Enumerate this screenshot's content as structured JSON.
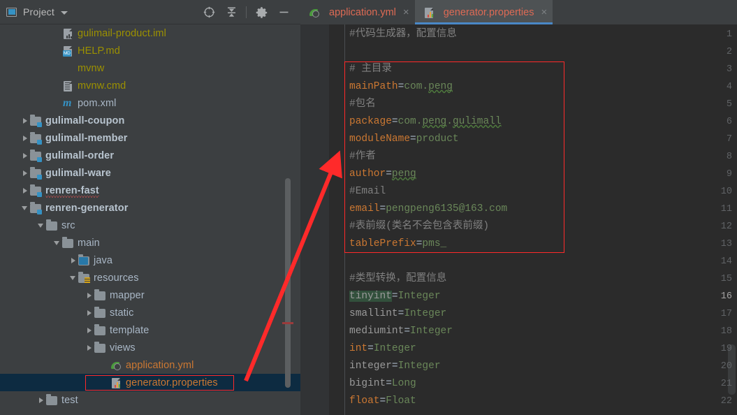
{
  "window": {
    "panel_title": "Project",
    "accent_blue": "#3592c4",
    "tab_underline": "#4a88c7",
    "annotation_red": "#ff2a2a",
    "sidebar_bg": "#3c3f41",
    "editor_bg": "#2b2b2b",
    "selection_bg": "#0d2b41"
  },
  "toolbar": {
    "icons": [
      {
        "name": "locate-target-icon",
        "title": "Select Opened File"
      },
      {
        "name": "collapse-all-icon",
        "title": "Collapse All"
      },
      {
        "name": "settings-gear-icon",
        "title": "Settings"
      },
      {
        "name": "minimize-icon",
        "title": "Hide"
      }
    ]
  },
  "tree": {
    "items": [
      {
        "label": "gulimail-product.iml",
        "indent": 3,
        "arrow": "none",
        "icon": "iml-file-icon",
        "style": "yellow"
      },
      {
        "label": "HELP.md",
        "indent": 3,
        "arrow": "none",
        "icon": "markdown-file-icon",
        "style": "yellow"
      },
      {
        "label": "mvnw",
        "indent": 3,
        "arrow": "none",
        "icon": "shell-script-icon",
        "style": "yellow"
      },
      {
        "label": "mvnw.cmd",
        "indent": 3,
        "arrow": "none",
        "icon": "cmd-script-icon",
        "style": "yellow"
      },
      {
        "label": "pom.xml",
        "indent": 3,
        "arrow": "none",
        "icon": "maven-pom-icon",
        "style": "plain"
      },
      {
        "label": "gulimall-coupon",
        "indent": 1,
        "arrow": "closed",
        "icon": "module-folder-icon",
        "style": "bold"
      },
      {
        "label": "gulimall-member",
        "indent": 1,
        "arrow": "closed",
        "icon": "module-folder-icon",
        "style": "bold"
      },
      {
        "label": "gulimall-order",
        "indent": 1,
        "arrow": "closed",
        "icon": "module-folder-icon",
        "style": "bold"
      },
      {
        "label": "gulimall-ware",
        "indent": 1,
        "arrow": "closed",
        "icon": "module-folder-icon",
        "style": "bold"
      },
      {
        "label": "renren-fast",
        "indent": 1,
        "arrow": "closed",
        "icon": "module-folder-icon",
        "style": "bold",
        "spellcheck_error": true
      },
      {
        "label": "renren-generator",
        "indent": 1,
        "arrow": "open",
        "icon": "module-folder-icon",
        "style": "bold"
      },
      {
        "label": "src",
        "indent": 2,
        "arrow": "open",
        "icon": "folder-icon",
        "style": "plain"
      },
      {
        "label": "main",
        "indent": 3,
        "arrow": "open",
        "icon": "folder-icon",
        "style": "plain"
      },
      {
        "label": "java",
        "indent": 4,
        "arrow": "closed",
        "icon": "sources-folder-icon",
        "style": "plain"
      },
      {
        "label": "resources",
        "indent": 4,
        "arrow": "open",
        "icon": "resources-folder-icon",
        "style": "plain"
      },
      {
        "label": "mapper",
        "indent": 5,
        "arrow": "closed",
        "icon": "folder-icon",
        "style": "plain"
      },
      {
        "label": "static",
        "indent": 5,
        "arrow": "closed",
        "icon": "folder-icon",
        "style": "plain"
      },
      {
        "label": "template",
        "indent": 5,
        "arrow": "closed",
        "icon": "folder-icon",
        "style": "plain"
      },
      {
        "label": "views",
        "indent": 5,
        "arrow": "closed",
        "icon": "folder-icon",
        "style": "plain"
      },
      {
        "label": "application.yml",
        "indent": 6,
        "arrow": "none",
        "icon": "yaml-spring-icon",
        "style": "orange"
      },
      {
        "label": "generator.properties",
        "indent": 6,
        "arrow": "none",
        "icon": "properties-file-icon",
        "style": "orange",
        "selected": true,
        "annotated": true
      },
      {
        "label": "test",
        "indent": 2,
        "arrow": "closed",
        "icon": "folder-icon",
        "style": "plain"
      }
    ]
  },
  "tabs": [
    {
      "label": "application.yml",
      "icon": "yaml-spring-icon",
      "active": false,
      "close": "×"
    },
    {
      "label": "generator.properties",
      "icon": "properties-file-icon",
      "active": true,
      "close": "×"
    }
  ],
  "editor": {
    "file": "generator.properties",
    "current_line": 16,
    "annotation_box_lines": [
      3,
      13
    ],
    "lines": [
      {
        "n": 1,
        "segments": [
          {
            "t": "#代码生成器，配置信息",
            "c": "cmt"
          }
        ]
      },
      {
        "n": 2,
        "segments": []
      },
      {
        "n": 3,
        "segments": [
          {
            "t": "# 主目录",
            "c": "cmt"
          }
        ]
      },
      {
        "n": 4,
        "segments": [
          {
            "t": "mainPath",
            "c": "key"
          },
          {
            "t": "=",
            "c": "eq"
          },
          {
            "t": "com.",
            "c": "val"
          },
          {
            "t": "peng",
            "c": "val",
            "sq": true
          }
        ]
      },
      {
        "n": 5,
        "segments": [
          {
            "t": "#包名",
            "c": "cmt"
          }
        ]
      },
      {
        "n": 6,
        "segments": [
          {
            "t": "package",
            "c": "key"
          },
          {
            "t": "=",
            "c": "eq"
          },
          {
            "t": "com.",
            "c": "val"
          },
          {
            "t": "peng",
            "c": "val",
            "sq": true
          },
          {
            "t": ".",
            "c": "val"
          },
          {
            "t": "gulimall",
            "c": "val",
            "sq": true
          }
        ]
      },
      {
        "n": 7,
        "segments": [
          {
            "t": "moduleName",
            "c": "key"
          },
          {
            "t": "=",
            "c": "eq"
          },
          {
            "t": "product",
            "c": "val"
          }
        ]
      },
      {
        "n": 8,
        "segments": [
          {
            "t": "#作者",
            "c": "cmt"
          }
        ]
      },
      {
        "n": 9,
        "segments": [
          {
            "t": "author",
            "c": "key"
          },
          {
            "t": "=",
            "c": "eq"
          },
          {
            "t": "peng",
            "c": "val",
            "sq": true
          }
        ]
      },
      {
        "n": 10,
        "segments": [
          {
            "t": "#Email",
            "c": "cmt"
          }
        ]
      },
      {
        "n": 11,
        "segments": [
          {
            "t": "email",
            "c": "key"
          },
          {
            "t": "=",
            "c": "eq"
          },
          {
            "t": "pengpeng6135@163.com",
            "c": "val"
          }
        ]
      },
      {
        "n": 12,
        "segments": [
          {
            "t": "#表前缀(类名不会包含表前缀)",
            "c": "cmt"
          }
        ]
      },
      {
        "n": 13,
        "segments": [
          {
            "t": "tablePrefix",
            "c": "key"
          },
          {
            "t": "=",
            "c": "eq"
          },
          {
            "t": "pms_",
            "c": "val"
          }
        ]
      },
      {
        "n": 14,
        "segments": []
      },
      {
        "n": 15,
        "segments": [
          {
            "t": "#类型转换，配置信息",
            "c": "cmt"
          }
        ]
      },
      {
        "n": 16,
        "segments": [
          {
            "t": "tinyint",
            "c": "keyg",
            "hl": true
          },
          {
            "t": "=",
            "c": "eq"
          },
          {
            "t": "Integer",
            "c": "val"
          }
        ]
      },
      {
        "n": 17,
        "segments": [
          {
            "t": "smallint",
            "c": "keyg"
          },
          {
            "t": "=",
            "c": "eq"
          },
          {
            "t": "Integer",
            "c": "val"
          }
        ]
      },
      {
        "n": 18,
        "segments": [
          {
            "t": "mediumint",
            "c": "keyg"
          },
          {
            "t": "=",
            "c": "eq"
          },
          {
            "t": "Integer",
            "c": "val"
          }
        ]
      },
      {
        "n": 19,
        "segments": [
          {
            "t": "int",
            "c": "key"
          },
          {
            "t": "=",
            "c": "eq"
          },
          {
            "t": "Integer",
            "c": "val"
          }
        ]
      },
      {
        "n": 20,
        "segments": [
          {
            "t": "integer",
            "c": "keyg"
          },
          {
            "t": "=",
            "c": "eq"
          },
          {
            "t": "Integer",
            "c": "val"
          }
        ]
      },
      {
        "n": 21,
        "segments": [
          {
            "t": "bigint",
            "c": "keyg"
          },
          {
            "t": "=",
            "c": "eq"
          },
          {
            "t": "Long",
            "c": "val"
          }
        ]
      },
      {
        "n": 22,
        "segments": [
          {
            "t": "float",
            "c": "key"
          },
          {
            "t": "=",
            "c": "eq"
          },
          {
            "t": "Float",
            "c": "val"
          }
        ]
      }
    ],
    "intention_bulb": "lightbulb-icon"
  }
}
